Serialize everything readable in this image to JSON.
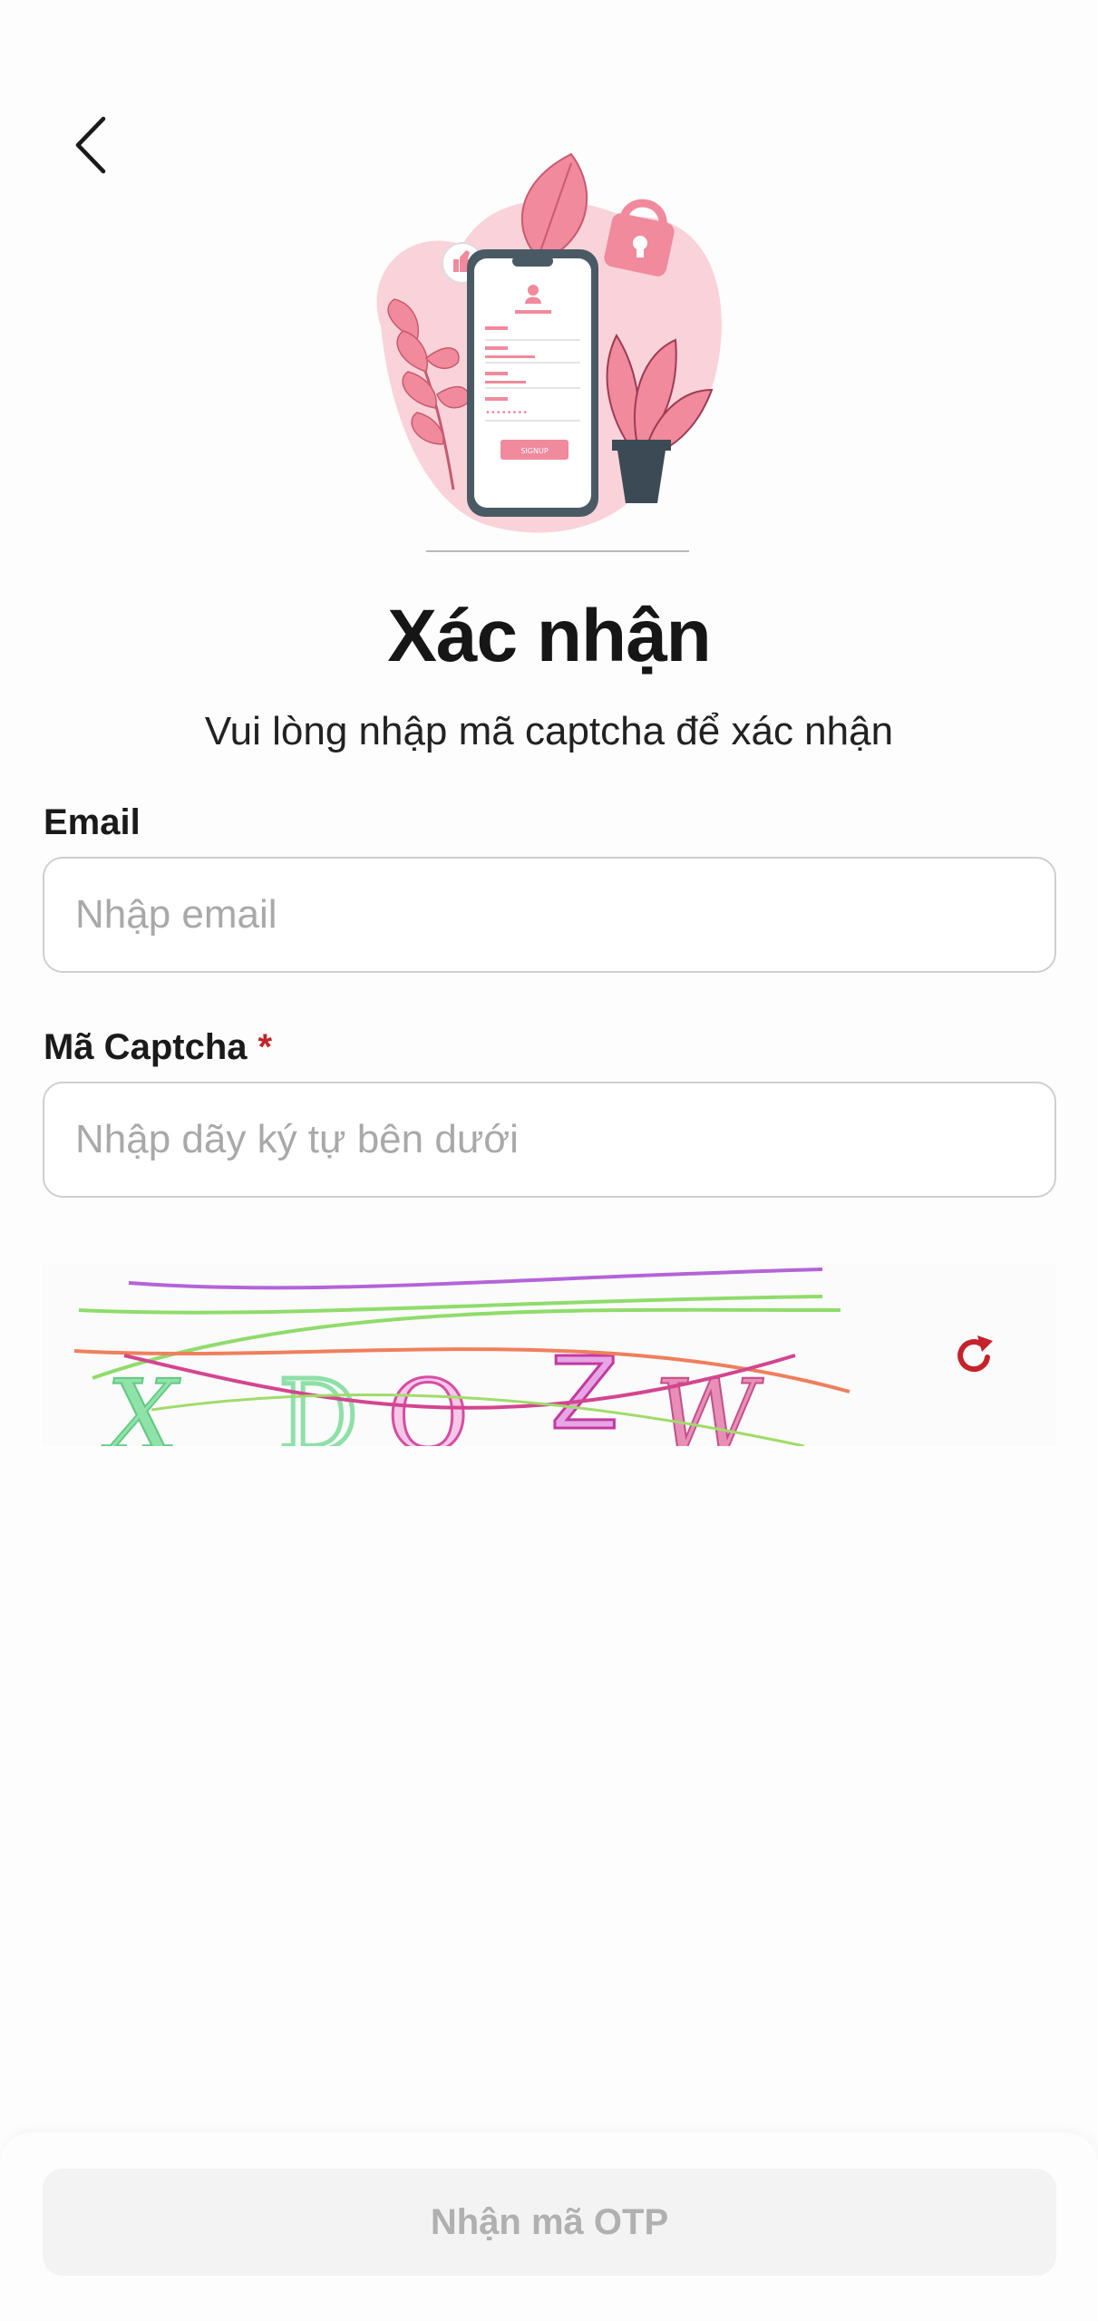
{
  "header": {
    "back_icon": "chevron-left-icon"
  },
  "illustration": {
    "icon": "phone-signup-illustration",
    "signup_label": "SIGNUP"
  },
  "title": "Xác nhận",
  "subtitle": "Vui lòng nhập mã captcha để xác nhận",
  "email": {
    "label": "Email",
    "placeholder": "Nhập email",
    "value": ""
  },
  "captcha_field": {
    "label": "Mã Captcha",
    "required_mark": "*",
    "placeholder": "Nhập dãy ký tự bên dưới",
    "value": ""
  },
  "captcha": {
    "text": "XDQZW",
    "refresh_icon": "refresh-icon"
  },
  "footer": {
    "submit_label": "Nhận mã OTP"
  },
  "colors": {
    "accent": "#c4232b",
    "disabled_bg": "#f3f3f3",
    "disabled_text": "#b0b0b0",
    "pink": "#f28b9c"
  }
}
